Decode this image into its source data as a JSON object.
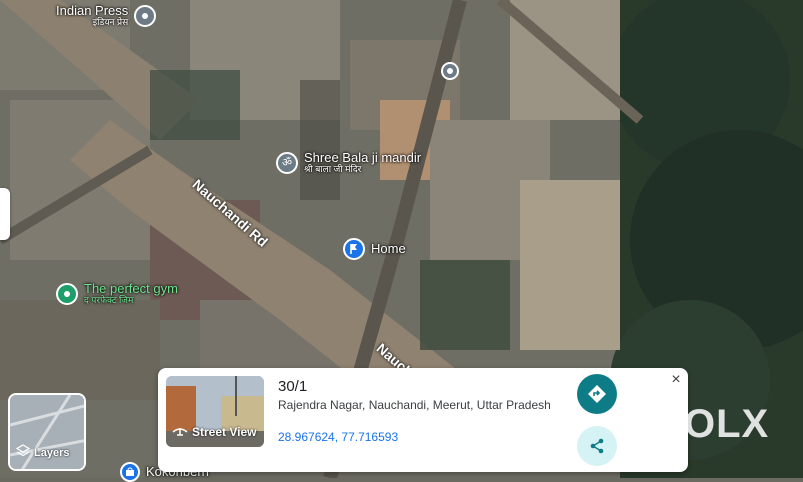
{
  "pois": [
    {
      "name": "Indian Press",
      "sub": "इंडियन प्रेस",
      "icon": "pin-icon"
    },
    {
      "name": "Shree Bala ji mandir",
      "sub": "श्री बाला जी मंदिर",
      "icon": "om-icon"
    },
    {
      "name": "Home",
      "sub": "",
      "icon": "flag-icon"
    },
    {
      "name": "The perfect gym",
      "sub": "द परफेक्ट जिम",
      "icon": "pin-icon"
    },
    {
      "name": "Kokonberri",
      "sub": "",
      "icon": "shopping-bag-icon"
    }
  ],
  "roads": [
    "Nauchandi Rd",
    "Nauch"
  ],
  "layers": {
    "label": "Layers"
  },
  "card": {
    "title": "30/1",
    "address": "Rajendra Nagar, Nauchandi, Meerut, Uttar Pradesh",
    "coordinates": "28.967624, 77.716593",
    "street_view_label": "Street View",
    "close_glyph": "×"
  },
  "watermark": "OLX",
  "colors": {
    "accent": "#0e7c86",
    "coords": "#1a73e8",
    "poi_green": "#6ee48e"
  }
}
